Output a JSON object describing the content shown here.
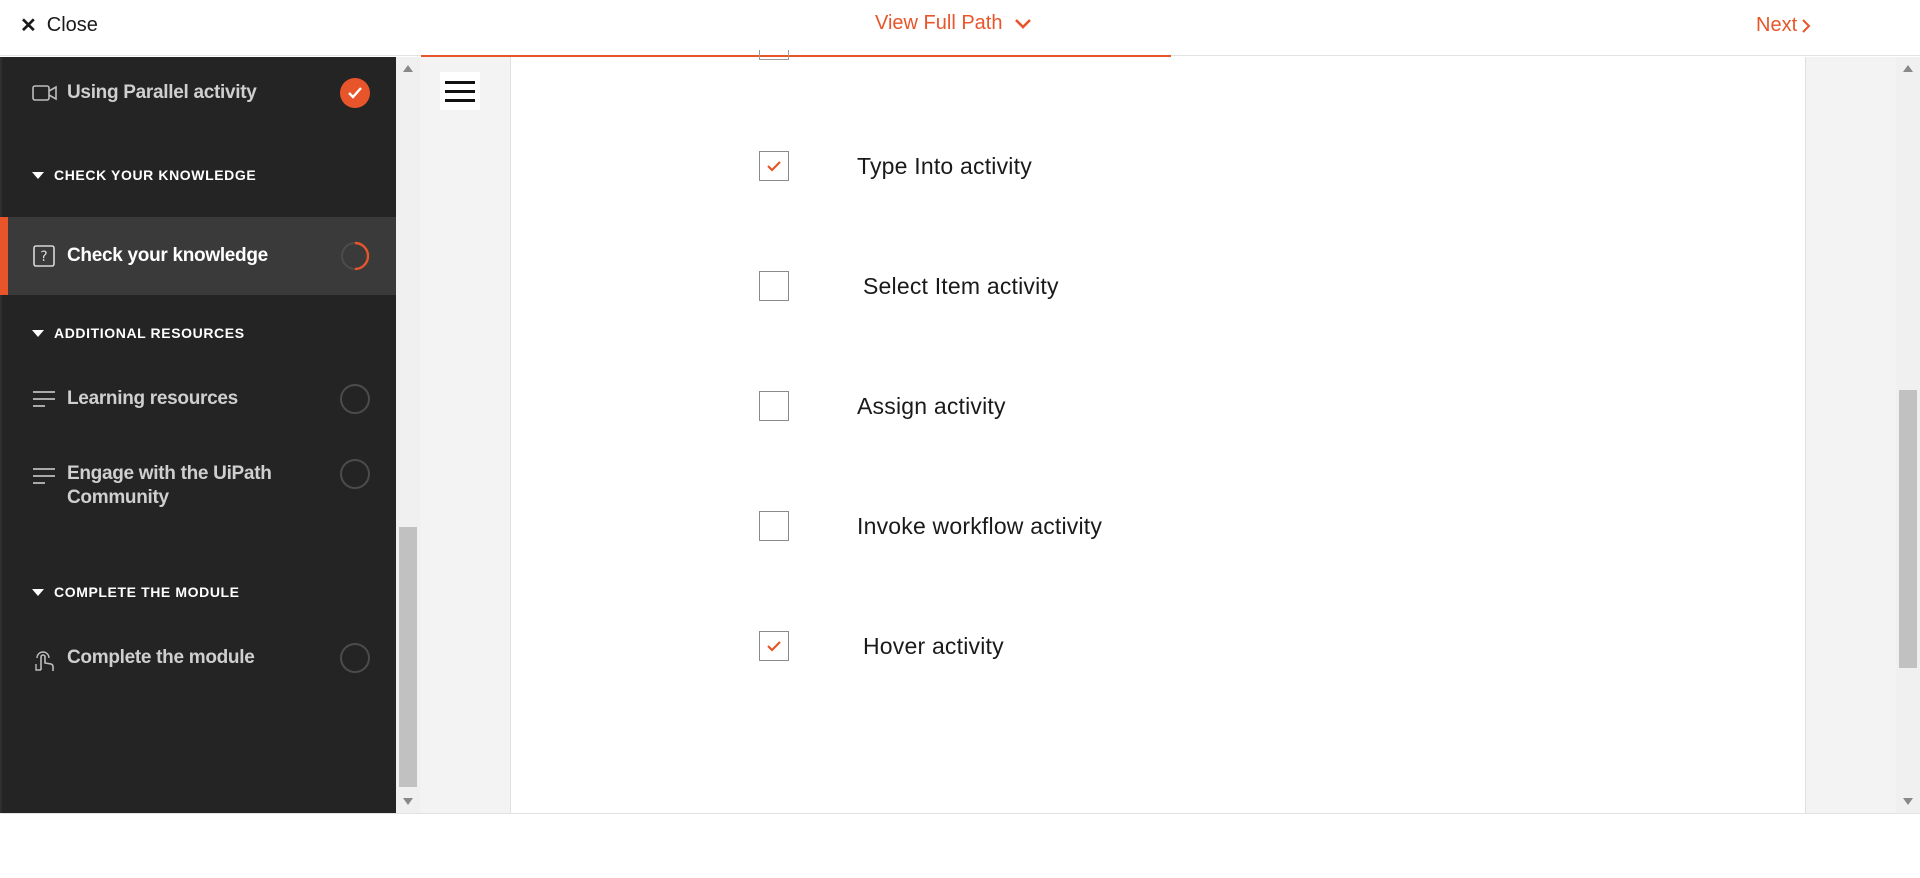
{
  "header": {
    "close_label": "Close",
    "view_path_label": "View Full Path",
    "next_label": "Next"
  },
  "sidebar": {
    "items": [
      {
        "label": "Using Parallel activity",
        "icon": "video-icon",
        "status": "done"
      },
      {
        "section": "CHECK YOUR KNOWLEDGE"
      },
      {
        "label": "Check your knowledge",
        "icon": "question-icon",
        "status": "in-progress",
        "active": true
      },
      {
        "section": "ADDITIONAL RESOURCES"
      },
      {
        "label": "Learning resources",
        "icon": "text-lines-icon",
        "status": "empty"
      },
      {
        "label": "Engage with the UiPath Community",
        "icon": "text-lines-icon",
        "status": "empty"
      },
      {
        "section": "COMPLETE THE MODULE"
      },
      {
        "label": "Complete the module",
        "icon": "touch-icon",
        "status": "empty"
      }
    ]
  },
  "quiz": {
    "options": [
      {
        "label": "Type Into activity",
        "checked": true
      },
      {
        "label": "Select Item activity",
        "checked": false
      },
      {
        "label": "Assign activity",
        "checked": false
      },
      {
        "label": "Invoke workflow activity",
        "checked": false
      },
      {
        "label": "Hover activity",
        "checked": true
      }
    ]
  },
  "colors": {
    "accent": "#e8552b",
    "sidebar_bg": "#242424",
    "sidebar_active_bg": "#3a3a3a"
  }
}
